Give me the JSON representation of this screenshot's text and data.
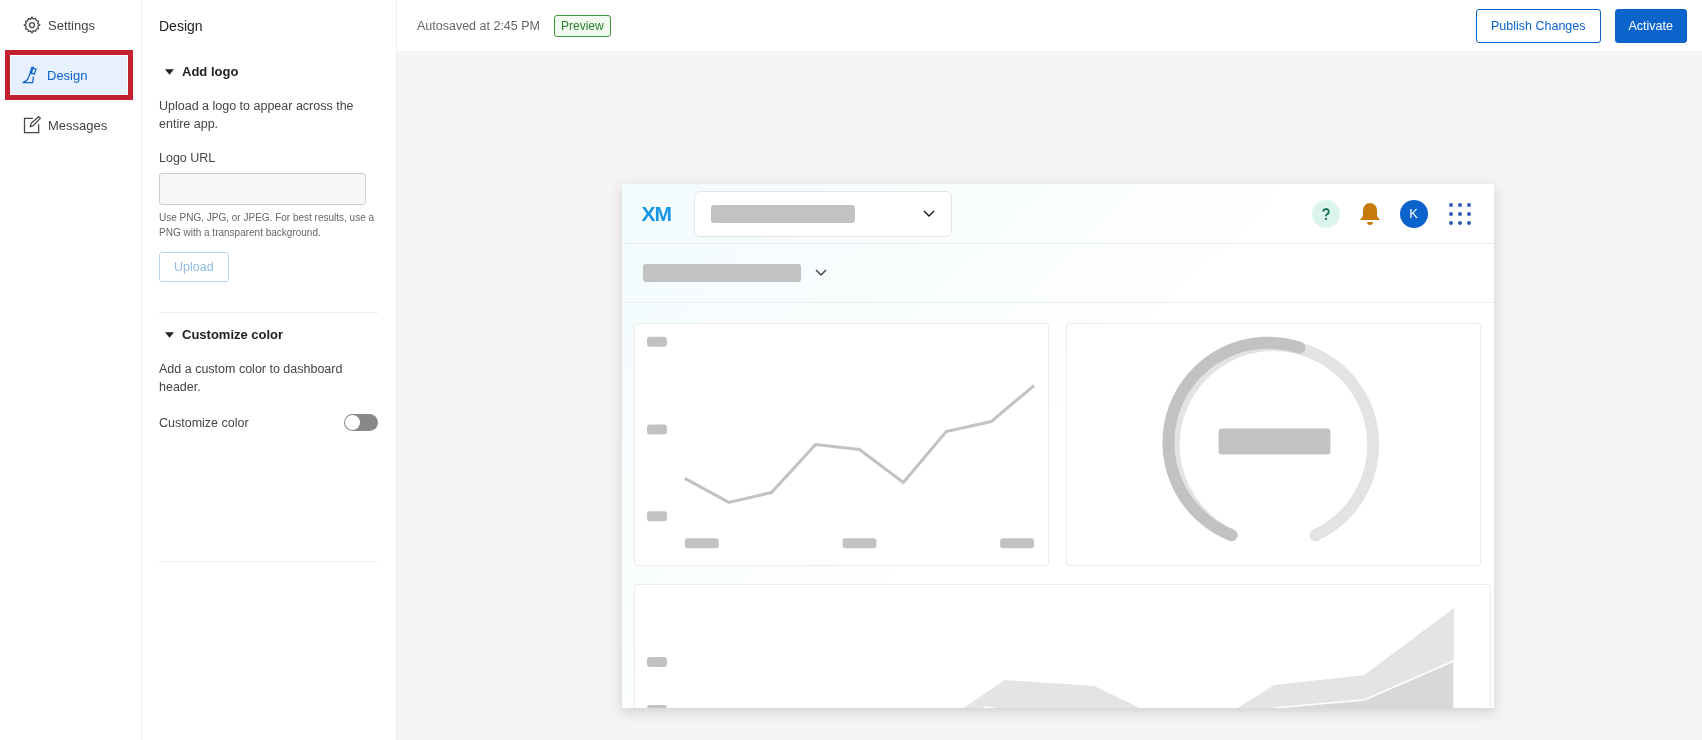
{
  "nav": {
    "items": [
      {
        "label": "Settings",
        "kind": "settings",
        "selected": false,
        "highlighted": false
      },
      {
        "label": "Design",
        "kind": "design",
        "selected": true,
        "highlighted": true
      },
      {
        "label": "Messages",
        "kind": "messages",
        "selected": false,
        "highlighted": false
      }
    ]
  },
  "panel": {
    "title": "Design",
    "sections": [
      {
        "kind": "logo",
        "title": "Add logo",
        "expanded": true,
        "description": "Upload a logo to appear across the entire app.",
        "field_label": "Logo URL",
        "hint": "Use PNG, JPG, or JPEG. For best results, use a PNG with a transparent background.",
        "button": {
          "label": "Upload",
          "disabled": true
        }
      },
      {
        "kind": "color",
        "title": "Customize color",
        "expanded": true,
        "description": "Add a custom color to dashboard header.",
        "toggle": {
          "label": "Customize color",
          "on": false
        }
      }
    ]
  },
  "topbar": {
    "status": "Autosaved at 2:45 PM",
    "badge": "Preview",
    "buttons": [
      {
        "label": "Publish Changes",
        "kind": "secondary"
      },
      {
        "label": "Activate",
        "kind": "primary"
      }
    ]
  },
  "preview": {
    "logo": "XM",
    "avatar": "K"
  }
}
